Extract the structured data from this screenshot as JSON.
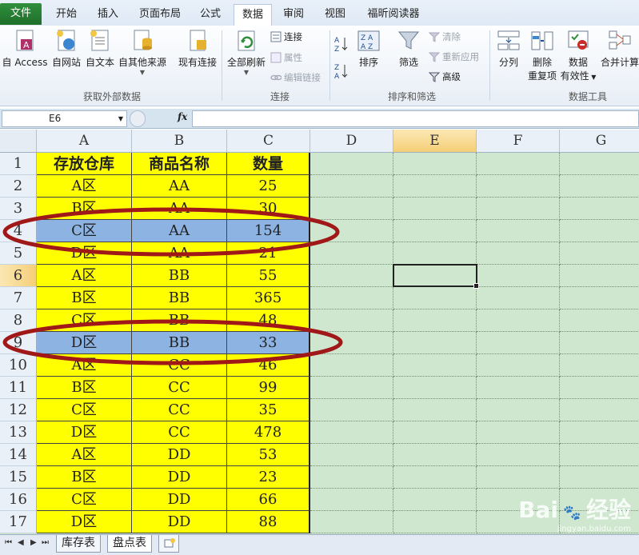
{
  "menu": {
    "tabs": [
      "文件",
      "开始",
      "插入",
      "页面布局",
      "公式",
      "数据",
      "审阅",
      "视图",
      "福昕阅读器"
    ],
    "active": "数据"
  },
  "ribbon": {
    "groups": {
      "external": "获取外部数据",
      "connections": "连接",
      "sort_filter": "排序和筛选",
      "tools": "数据工具"
    },
    "buttons": {
      "access": "自 Access",
      "web": "自网站",
      "text": "自文本",
      "other": "自其他来源",
      "existing": "现有连接",
      "refresh_all": "全部刷新",
      "connections": "连接",
      "properties": "属性",
      "edit_links": "编辑链接",
      "sort": "排序",
      "filter": "筛选",
      "clear": "清除",
      "reapply": "重新应用",
      "advanced": "高级",
      "split": "分列",
      "remove_dup_1": "删除",
      "remove_dup_2": "重复项",
      "validation_1": "数据",
      "validation_2": "有效性",
      "consolidate": "合并计算"
    }
  },
  "formula_bar": {
    "name_box": "E6",
    "fx": "fx",
    "formula": ""
  },
  "grid": {
    "columns": [
      "A",
      "B",
      "C",
      "D",
      "E",
      "F",
      "G"
    ],
    "selected_column": "E",
    "selected_row": 6,
    "selected_cell": "E6",
    "header": [
      "存放仓库",
      "商品名称",
      "数量"
    ],
    "rows": [
      {
        "n": "2",
        "a": "A区",
        "b": "AA",
        "c": "25"
      },
      {
        "n": "3",
        "a": "B区",
        "b": "AA",
        "c": "30"
      },
      {
        "n": "4",
        "a": "C区",
        "b": "AA",
        "c": "154",
        "hl": true
      },
      {
        "n": "5",
        "a": "D区",
        "b": "AA",
        "c": "21"
      },
      {
        "n": "6",
        "a": "A区",
        "b": "BB",
        "c": "55"
      },
      {
        "n": "7",
        "a": "B区",
        "b": "BB",
        "c": "365"
      },
      {
        "n": "8",
        "a": "C区",
        "b": "BB",
        "c": "48"
      },
      {
        "n": "9",
        "a": "D区",
        "b": "BB",
        "c": "33",
        "hl": true
      },
      {
        "n": "10",
        "a": "A区",
        "b": "CC",
        "c": "46"
      },
      {
        "n": "11",
        "a": "B区",
        "b": "CC",
        "c": "99"
      },
      {
        "n": "12",
        "a": "C区",
        "b": "CC",
        "c": "35"
      },
      {
        "n": "13",
        "a": "D区",
        "b": "CC",
        "c": "478"
      },
      {
        "n": "14",
        "a": "A区",
        "b": "DD",
        "c": "53"
      },
      {
        "n": "15",
        "a": "B区",
        "b": "DD",
        "c": "23"
      },
      {
        "n": "16",
        "a": "C区",
        "b": "DD",
        "c": "66"
      },
      {
        "n": "17",
        "a": "D区",
        "b": "DD",
        "c": "88"
      }
    ],
    "colors": {
      "fill": "#ffff00",
      "highlight": "#8db3e2",
      "background": "#cfe7cf",
      "annotation": "#a01818"
    }
  },
  "sheets": [
    "库存表",
    "盘点表"
  ],
  "active_sheet": "盘点表",
  "watermark": {
    "brand": "Bai",
    "brand2": "经验",
    "url": "jingyan.baidu.com"
  }
}
